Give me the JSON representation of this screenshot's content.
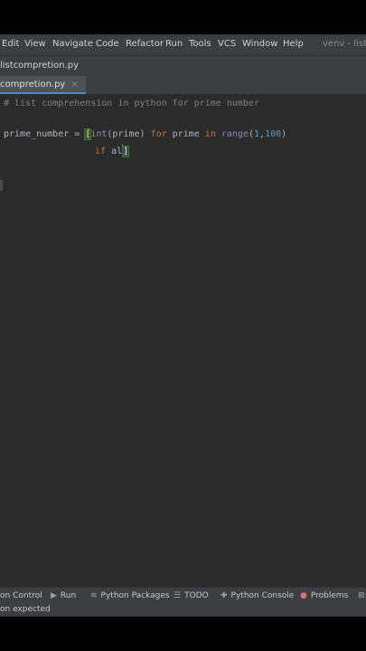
{
  "menubar": {
    "items": [
      "Edit",
      "View",
      "Navigate",
      "Code",
      "Refactor",
      "Run",
      "Tools",
      "VCS",
      "Window",
      "Help"
    ],
    "project_label": "venv - listc"
  },
  "breadcrumb": {
    "file": "listcompretion.py"
  },
  "tabs": [
    {
      "label": "compretion.py",
      "close": "×"
    }
  ],
  "editor": {
    "comment": "# list comprehension in python for prime number",
    "line2": {
      "var": "prime_number",
      "op": " = ",
      "bracket": "[",
      "int": "int",
      "args": "(prime) ",
      "for": "for",
      "mid": " prime ",
      "in": "in",
      "range": "range",
      "range_open": "(",
      "n1": "1",
      "comma": ",",
      "n2": "100",
      "range_close": ")"
    },
    "line3": {
      "kw": "if",
      "rest": " al",
      "bracket": "]"
    }
  },
  "toolwindows": [
    {
      "label": "on Control",
      "icon": ""
    },
    {
      "label": "Run",
      "icon": "▶"
    },
    {
      "label": "Python Packages",
      "icon": "≋"
    },
    {
      "label": "TODO",
      "icon": "☰"
    },
    {
      "label": "Python Console",
      "icon": "✚"
    },
    {
      "label": "Problems",
      "icon": "●"
    },
    {
      "label": "",
      "icon": "⊠"
    }
  ],
  "status": {
    "message": "on expected"
  },
  "colors": {
    "editor_bg": "#2b2b2b",
    "chrome_bg": "#3c3f41",
    "keyword": "#cc7832",
    "comment": "#808080",
    "number": "#6897bb",
    "builtin": "#8888c6",
    "tab_underline": "#4a88c7",
    "problems_icon": "#e06c75"
  }
}
